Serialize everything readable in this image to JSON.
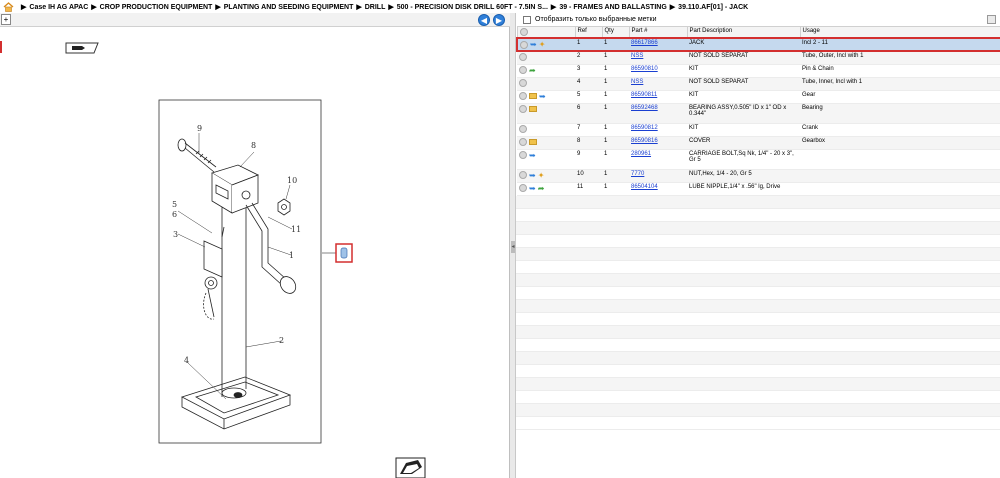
{
  "breadcrumb": [
    "Case IH AG APAC",
    "CROP PRODUCTION EQUIPMENT",
    "PLANTING AND SEEDING EQUIPMENT",
    "DRILL",
    "500 - PRECISION DISK DRILL 60FT - 7.5IN S...",
    "39 - FRAMES AND BALLASTING",
    "39.110.AF[01] - JACK"
  ],
  "left_panel": {
    "expand_label": "+",
    "back_label": "◀",
    "forward_label": "▶",
    "callout_numbers": [
      "9",
      "8",
      "10",
      "5",
      "6",
      "3",
      "11",
      "1",
      "2",
      "4"
    ]
  },
  "right_panel": {
    "filter_label": "Отобразить только выбранные метки",
    "columns": [
      "",
      "Ref",
      "Qty",
      "Part #",
      "Part Description",
      "Usage"
    ],
    "rows": [
      {
        "icons": [
          "blue",
          "puzzle"
        ],
        "ref": "1",
        "qty": "1",
        "part": "86617866",
        "desc": "JACK",
        "usage": "Incl 2 - 11",
        "selected": true
      },
      {
        "icons": [],
        "ref": "2",
        "qty": "1",
        "part": "NSS",
        "desc": "NOT SOLD SEPARAT",
        "usage": "Tube, Outer, Incl with 1"
      },
      {
        "icons": [
          "green"
        ],
        "ref": "3",
        "qty": "1",
        "part": "86590810",
        "desc": "KIT",
        "usage": "Pin & Chain"
      },
      {
        "icons": [],
        "ref": "4",
        "qty": "1",
        "part": "NSS",
        "desc": "NOT SOLD SEPARAT",
        "usage": "Tube, Inner, Incl with 1"
      },
      {
        "icons": [
          "folder",
          "blue"
        ],
        "ref": "5",
        "qty": "1",
        "part": "86590811",
        "desc": "KIT",
        "usage": "Gear"
      },
      {
        "icons": [
          "folder"
        ],
        "ref": "6",
        "qty": "1",
        "part": "86592468",
        "desc": "BEARING ASSY,0.505\" ID x 1\" OD x 0.344\"",
        "usage": "Bearing",
        "tall": true
      },
      {
        "icons": [],
        "ref": "7",
        "qty": "1",
        "part": "86590812",
        "desc": "KIT",
        "usage": "Crank"
      },
      {
        "icons": [
          "folder"
        ],
        "ref": "8",
        "qty": "1",
        "part": "86590816",
        "desc": "COVER",
        "usage": "Gearbox"
      },
      {
        "icons": [
          "blue"
        ],
        "ref": "9",
        "qty": "1",
        "part": "280961",
        "desc": "CARRIAGE BOLT,Sq Nk, 1/4\" - 20 x 3\", Gr 5",
        "usage": "",
        "tall": true
      },
      {
        "icons": [
          "blue",
          "puzzle"
        ],
        "ref": "10",
        "qty": "1",
        "part": "7770",
        "desc": "NUT,Hex, 1/4 - 20, Gr 5",
        "usage": ""
      },
      {
        "icons": [
          "blue",
          "green"
        ],
        "ref": "11",
        "qty": "1",
        "part": "86504104",
        "desc": "LUBE NIPPLE,1/4\" x .56\" lg, Drive",
        "usage": ""
      }
    ]
  }
}
